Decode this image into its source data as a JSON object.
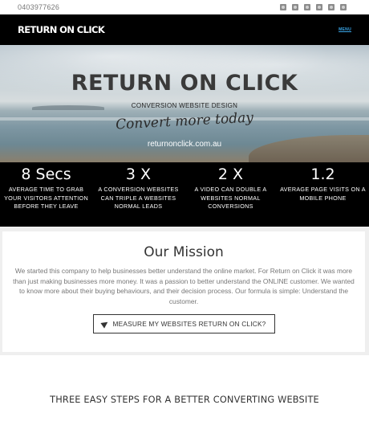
{
  "topbar": {
    "phone": "0403977626",
    "social_icons": [
      "facebook-icon",
      "twitter-icon",
      "google-plus-icon",
      "instagram-icon",
      "pinterest-icon",
      "rss-icon"
    ]
  },
  "nav": {
    "logo": "RETURN ON CLICK",
    "menu_label": "MENU"
  },
  "hero": {
    "title": "RETURN ON CLICK",
    "subtitle": "CONVERSION WEBSITE DESIGN",
    "tagline": "Convert more today",
    "url": "returnonclick.com.au"
  },
  "stats": [
    {
      "number": "8 Secs",
      "text": "AVERAGE TIME TO GRAB YOUR VISITORS ATTENTION BEFORE THEY LEAVE"
    },
    {
      "number": "3 X",
      "text": "A CONVERSION WEBSITES CAN TRIPLE A WEBSITES NORMAL LEADS"
    },
    {
      "number": "2 X",
      "text": "A VIDEO CAN DOUBLE A WEBSITES NORMAL CONVERSIONS"
    },
    {
      "number": "1.2",
      "text": "AVERAGE PAGE VISITS ON A MOBILE PHONE"
    }
  ],
  "mission": {
    "heading": "Our Mission",
    "body": "We started this company to help businesses better understand the online market. For Return on Click it was more than just making businesses more money. It was a passion to better understand the ONLINE customer. We wanted to know more about their buying behaviours, and their decision process. Our formula is simple: Understand the customer.",
    "cta_label": "MEASURE MY WEBSITES RETURN ON CLICK?"
  },
  "steps": {
    "heading": "THREE EASY STEPS FOR A BETTER CONVERTING WEBSITE"
  },
  "colors": {
    "nav_bg": "#000000",
    "menu_link": "#3aa6e8",
    "stats_bg": "#000000"
  }
}
